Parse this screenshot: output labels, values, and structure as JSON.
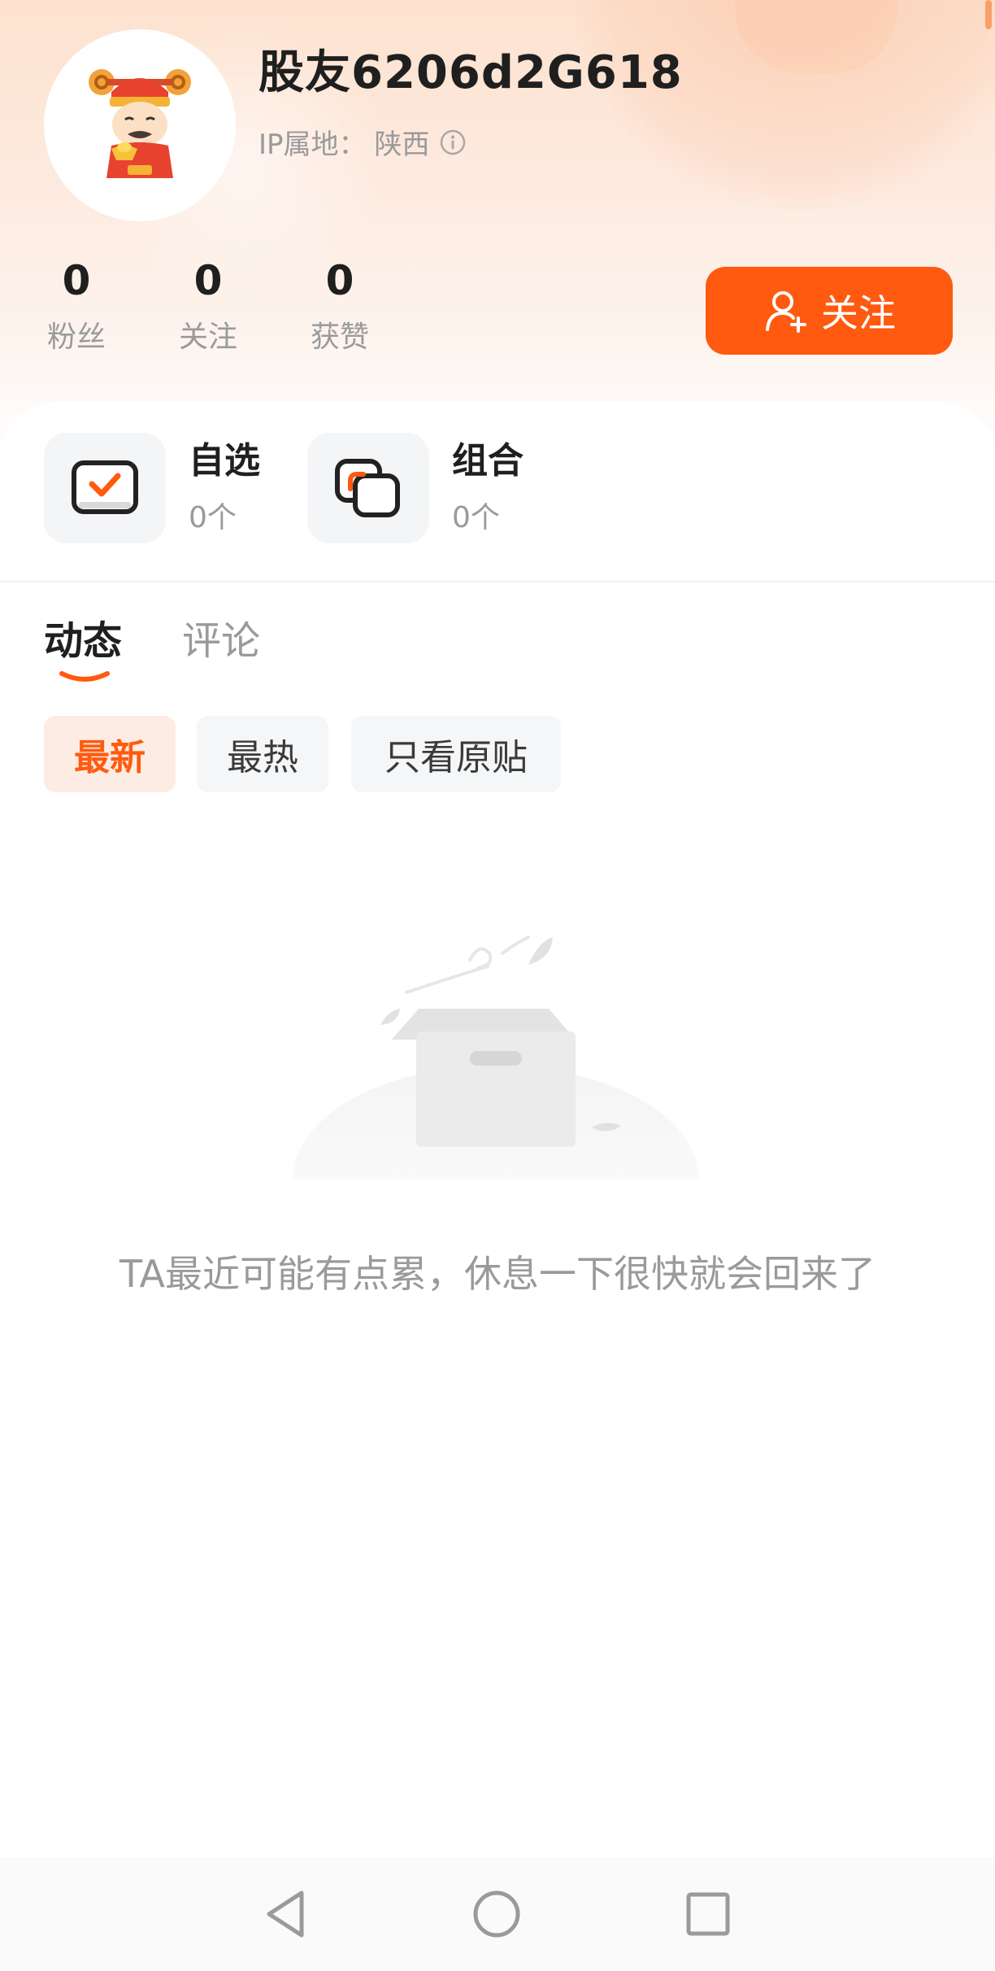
{
  "profile": {
    "username": "股友6206d2G618",
    "ip_label": "IP属地：",
    "ip_location": "陕西",
    "avatar_icon": "caishen-avatar-icon"
  },
  "stats": [
    {
      "value": "0",
      "label": "粉丝"
    },
    {
      "value": "0",
      "label": "关注"
    },
    {
      "value": "0",
      "label": "获赞"
    }
  ],
  "follow_button": {
    "label": "关注",
    "icon": "add-user-icon"
  },
  "assets": [
    {
      "title": "自选",
      "count": "0个",
      "icon": "checkbox-icon"
    },
    {
      "title": "组合",
      "count": "0个",
      "icon": "portfolio-icon"
    }
  ],
  "tabs": [
    {
      "label": "动态",
      "active": true
    },
    {
      "label": "评论",
      "active": false
    }
  ],
  "filters": [
    {
      "label": "最新",
      "active": true
    },
    {
      "label": "最热",
      "active": false
    },
    {
      "label": "只看原贴",
      "active": false
    }
  ],
  "empty_state": {
    "message": "TA最近可能有点累，休息一下很快就会回来了",
    "icon": "empty-box-icon"
  },
  "system_nav": {
    "back": "back-icon",
    "home": "home-icon",
    "recents": "recents-icon"
  },
  "colors": {
    "accent": "#ff5a10",
    "chip_active_bg": "#fdece3",
    "text_primary": "#1f1f1f",
    "text_secondary": "#9a9a9a"
  }
}
